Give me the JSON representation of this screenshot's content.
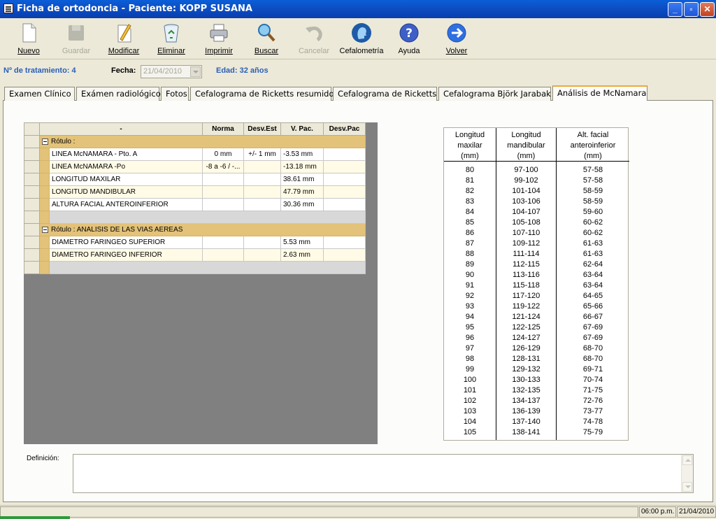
{
  "window": {
    "title": "Ficha de ortodoncia - Paciente: KOPP SUSANA",
    "minimize": "_",
    "maximize": "▫",
    "close": "✕"
  },
  "toolbar": {
    "nuevo": "Nuevo",
    "guardar": "Guardar",
    "modificar": "Modificar",
    "eliminar": "Eliminar",
    "imprimir": "Imprimir",
    "buscar": "Buscar",
    "cancelar": "Cancelar",
    "cefalometria": "Cefalometría",
    "ayuda": "Ayuda",
    "volver": "Volver"
  },
  "info": {
    "tratamiento": "Nº de tratamiento: 4",
    "fecha_label": "Fecha:",
    "fecha_value": "21/04/2010",
    "edad": "Edad: 32 años"
  },
  "tabs": [
    "Examen Clínico",
    "Exámen radiológico",
    "Fotos",
    "Cefalograma de Ricketts resumido",
    "Cefalograma de Ricketts",
    "Cefalograma Björk Jarabak",
    "Análisis de McNamara"
  ],
  "grid": {
    "headers": [
      "-",
      "Norma",
      "Desv.Est",
      "V. Pac.",
      "Desv.Pac"
    ],
    "group1": "Rótulo :",
    "group2": "Rótulo : ANALISIS DE LAS VIAS AEREAS",
    "rows1": [
      {
        "name": "LINEA McNAMARA - Pto. A",
        "norma": "0 mm",
        "desv": "+/- 1 mm",
        "vpac": "-3.53 mm",
        "desvpac": ""
      },
      {
        "name": "LINEA McNAMARA -Po",
        "norma": "-8 a -6 / -...",
        "desv": "",
        "vpac": "-13.18 mm",
        "desvpac": ""
      },
      {
        "name": "LONGITUD MAXILAR",
        "norma": "",
        "desv": "",
        "vpac": "38.61 mm",
        "desvpac": ""
      },
      {
        "name": "LONGITUD MANDIBULAR",
        "norma": "",
        "desv": "",
        "vpac": "47.79 mm",
        "desvpac": ""
      },
      {
        "name": "ALTURA FACIAL ANTEROINFERIOR",
        "norma": "",
        "desv": "",
        "vpac": "30.36 mm",
        "desvpac": ""
      }
    ],
    "rows2": [
      {
        "name": "DIAMETRO FARINGEO SUPERIOR",
        "norma": "",
        "desv": "",
        "vpac": "5.53 mm",
        "desvpac": ""
      },
      {
        "name": "DIAMETRO FARINGEO INFERIOR",
        "norma": "",
        "desv": "",
        "vpac": "2.63 mm",
        "desvpac": ""
      }
    ]
  },
  "reference": {
    "headers": [
      "Longitud\nmaxilar\n(mm)",
      "Longitud\nmandibular\n(mm)",
      "Alt. facial\nanteroinferior\n(mm)"
    ],
    "maxilar": [
      "80",
      "81",
      "82",
      "83",
      "84",
      "85",
      "86",
      "87",
      "88",
      "89",
      "90",
      "91",
      "92",
      "93",
      "94",
      "95",
      "96",
      "97",
      "98",
      "99",
      "100",
      "101",
      "102",
      "103",
      "104",
      "105"
    ],
    "mandibular": [
      "97-100",
      "99-102",
      "101-104",
      "103-106",
      "104-107",
      "105-108",
      "107-110",
      "109-112",
      "111-114",
      "112-115",
      "113-116",
      "115-118",
      "117-120",
      "119-122",
      "121-124",
      "122-125",
      "124-127",
      "126-129",
      "128-131",
      "129-132",
      "130-133",
      "132-135",
      "134-137",
      "136-139",
      "137-140",
      "138-141"
    ],
    "facial": [
      "57-58",
      "57-58",
      "58-59",
      "58-59",
      "59-60",
      "60-62",
      "60-62",
      "61-63",
      "61-63",
      "62-64",
      "63-64",
      "63-64",
      "64-65",
      "65-66",
      "66-67",
      "67-69",
      "67-69",
      "68-70",
      "68-70",
      "69-71",
      "70-74",
      "71-75",
      "72-76",
      "73-77",
      "74-78",
      "75-79"
    ]
  },
  "definicion": {
    "label": "Definición:",
    "value": ""
  },
  "status": {
    "time": "06:00 p.m.",
    "date": "21/04/2010"
  }
}
